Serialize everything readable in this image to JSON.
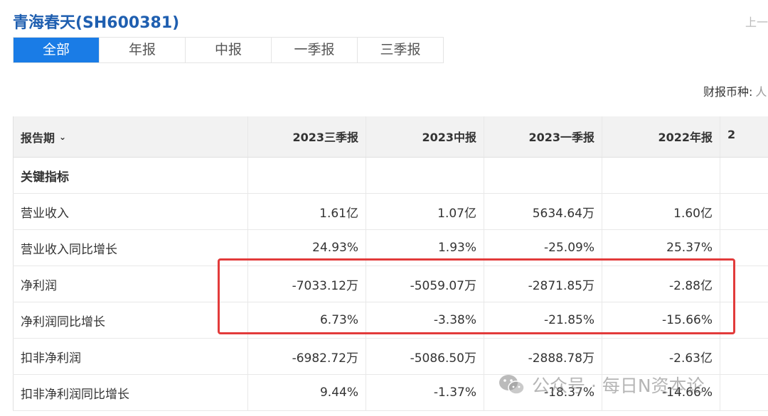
{
  "header": {
    "title": "青海春天(SH600381)",
    "nav_prev": "上一"
  },
  "tabs": [
    {
      "label": "全部",
      "active": true
    },
    {
      "label": "年报",
      "active": false
    },
    {
      "label": "中报",
      "active": false
    },
    {
      "label": "一季报",
      "active": false
    },
    {
      "label": "三季报",
      "active": false
    }
  ],
  "currency": {
    "label": "财报币种:",
    "value": "人"
  },
  "table": {
    "period_header": "报告期",
    "columns": [
      "2023三季报",
      "2023中报",
      "2023一季报",
      "2022年报",
      "2"
    ],
    "section": "关键指标",
    "rows": [
      {
        "label": "营业收入",
        "values": [
          "1.61亿",
          "1.07亿",
          "5634.64万",
          "1.60亿",
          ""
        ]
      },
      {
        "label": "营业收入同比增长",
        "values": [
          "24.93%",
          "1.93%",
          "-25.09%",
          "25.37%",
          ""
        ]
      },
      {
        "label": "净利润",
        "values": [
          "-7033.12万",
          "-5059.07万",
          "-2871.85万",
          "-2.88亿",
          ""
        ]
      },
      {
        "label": "净利润同比增长",
        "values": [
          "6.73%",
          "-3.38%",
          "-21.85%",
          "-15.66%",
          ""
        ]
      },
      {
        "label": "扣非净利润",
        "values": [
          "-6982.72万",
          "-5086.50万",
          "-2888.78万",
          "-2.63亿",
          ""
        ]
      },
      {
        "label": "扣非净利润同比增长",
        "values": [
          "9.44%",
          "-1.37%",
          "-18.37%",
          "-14.66%",
          ""
        ]
      }
    ]
  },
  "watermark": {
    "text": "公众号 · 每日N资本论"
  },
  "colors": {
    "accent": "#1a7ce6",
    "title": "#1f5fb0",
    "highlight": "#e23b3b"
  }
}
